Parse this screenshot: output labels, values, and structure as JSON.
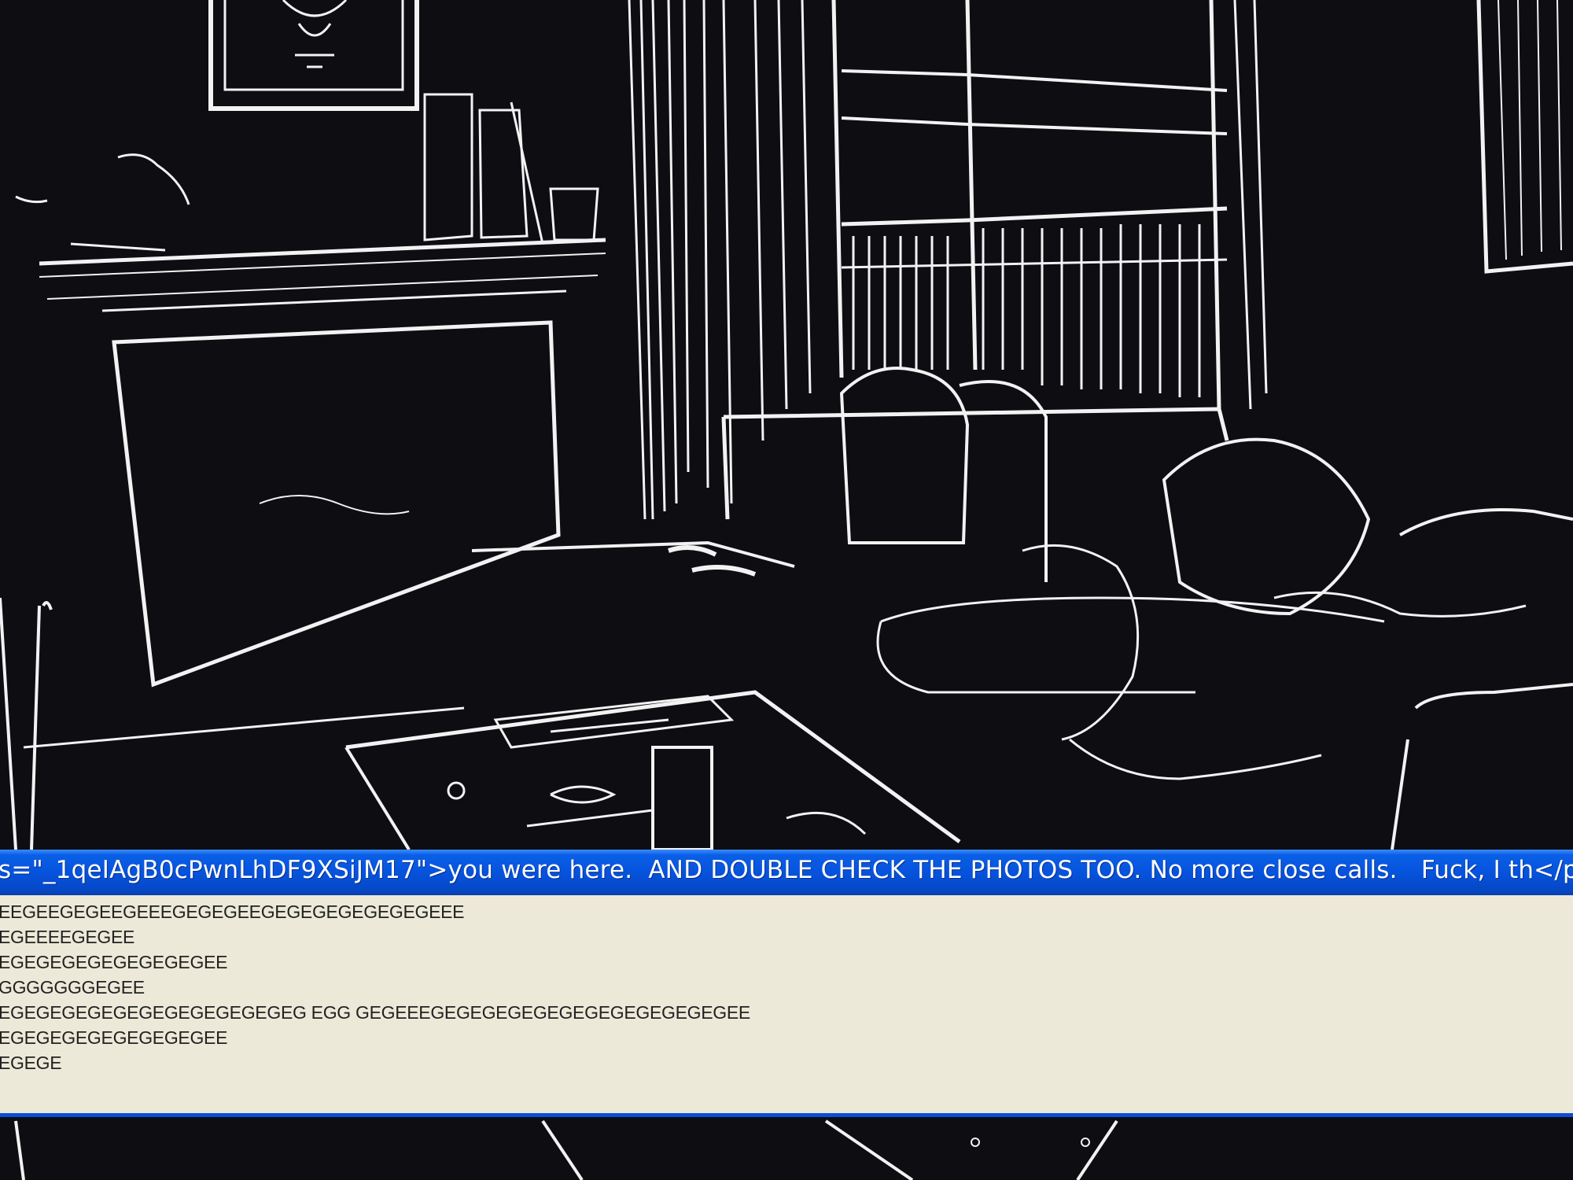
{
  "dialog": {
    "title": "s=\"_1qeIAgB0cPwnLhDF9XSiJM17\">you were here.  AND DOUBLE CHECK THE PHOTOS TOO. No more close calls.   Fuck, I th</p",
    "lines": [
      "EEGEEGEGEEGEEEGEGEGEEGEGEGEGEGEGEGEEE",
      "EGEEEEGEGEE",
      "EGEGEGEGEGEGEGEGEE",
      "GGGGGGGEGEE",
      "EGEGEGEGEGEGEGEGEGEGEGEG EGG GEGEEEGEGEGEGEGEGEGEGEGEGEGEGEE",
      "EGEGEGEGEGEGEGEGEE",
      "EGEGE"
    ]
  },
  "colors": {
    "titlebar": "#0653dd",
    "dialog_body": "#ece9d8",
    "scene_background": "#0d0d12",
    "scene_lines": "#f2f2f2"
  }
}
